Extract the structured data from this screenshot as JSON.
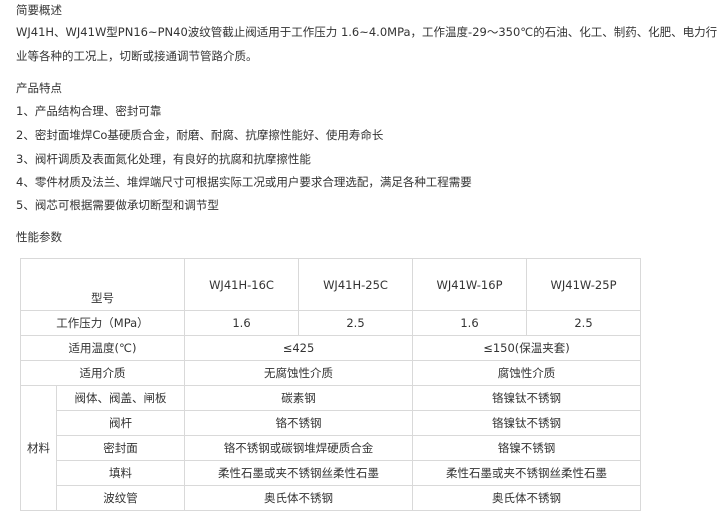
{
  "overview": {
    "heading": "简要概述",
    "text": "WJ41H、WJ41W型PN16~PN40波纹管截止阀适用于工作压力 1.6~4.0MPa，工作温度-29～350℃的石油、化工、制药、化肥、电力行业等各种的工况上，切断或接通调节管路介质。"
  },
  "features": {
    "heading": "产品特点",
    "items": [
      "1、产品结构合理、密封可靠",
      "2、密封面堆焊Co基硬质合金，耐磨、耐腐、抗摩擦性能好、使用寿命长",
      "3、阀杆调质及表面氮化处理，有良好的抗腐和抗摩擦性能",
      "4、零件材质及法兰、堆焊端尺寸可根据实际工况或用户要求合理选配，满足各种工程需要",
      "5、阀芯可根据需要做承切断型和调节型"
    ]
  },
  "performance": {
    "heading": "性能参数",
    "table": {
      "model_label": "型号",
      "models": [
        "WJ41H-16C",
        "WJ41H-25C",
        "WJ41W-16P",
        "WJ41W-25P"
      ],
      "pressure_label": "工作压力（MPa）",
      "pressures": [
        "1.6",
        "2.5",
        "1.6",
        "2.5"
      ],
      "temp_label": "适用温度(℃)",
      "temps": [
        "≤425",
        "≤150(保温夹套)"
      ],
      "medium_label": "适用介质",
      "media": [
        "无腐蚀性介质",
        "腐蚀性介质"
      ],
      "materials_label": "材料",
      "materials": [
        {
          "part": "阀体、阀盖、闸板",
          "h": "碳素钢",
          "w": "铬镍钛不锈钢"
        },
        {
          "part": "阀杆",
          "h": "铬不锈钢",
          "w": "铬镍钛不锈钢"
        },
        {
          "part": "密封面",
          "h": "铬不锈钢或碳钢堆焊硬质合金",
          "w": "铬镍不锈钢"
        },
        {
          "part": "填料",
          "h": "柔性石墨或夹不锈钢丝柔性石墨",
          "w": "柔性石墨或夹不锈钢丝柔性石墨"
        },
        {
          "part": "波纹管",
          "h": "奥氏体不锈钢",
          "w": "奥氏体不锈钢"
        }
      ]
    }
  }
}
